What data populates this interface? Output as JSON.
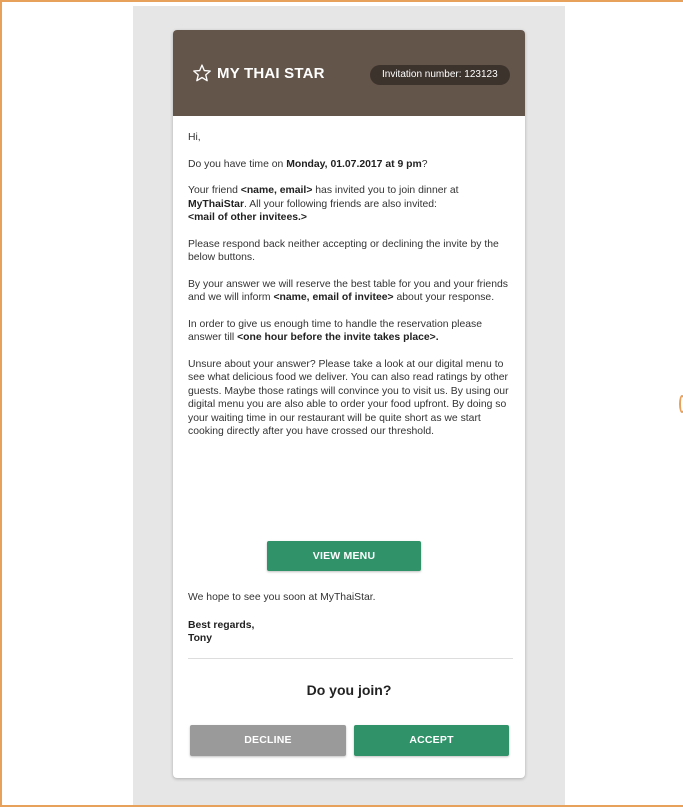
{
  "header": {
    "brand": "MY THAI STAR",
    "invitation": "Invitation number: 123123"
  },
  "body": {
    "greeting": "Hi,",
    "q_prefix": "Do you have time on ",
    "q_date": "Monday, 01.07.2017 at 9 pm",
    "q_suffix": "?",
    "friend_prefix": "Your friend ",
    "friend_name": "<name, email>",
    "friend_mid": " has invited you to join dinner at ",
    "friend_brand": "MyThaiStar",
    "friend_suffix": ". All your following friends are also invited: ",
    "friend_others": "<mail of other invitees.>",
    "respond": "Please respond back neither accepting or declining the invite by the below buttons.",
    "reserve_prefix": "By your answer we will reserve the best table for you and your friends and we will inform ",
    "reserve_name": "<name, email of invitee>",
    "reserve_suffix": " about your response.",
    "order_prefix": "In order to give us enough time to handle the reservation please answer till ",
    "order_time": "<one hour before the invite takes place>.",
    "unsure": "Unsure about your answer? Please take a look at our digital menu to see what delicious food we deliver. You can also read ratings by other guests. Maybe those ratings will convince you to visit us. By using our digital menu you are also able to order your food upfront.  By doing so your waiting time in our restaurant will be quite short as we start cooking directly after you have crossed our threshold.",
    "view_menu": "VIEW MENU",
    "hope": "We hope to see you soon at MyThaiStar.",
    "regards": "Best regards,",
    "signature": "Tony"
  },
  "footer": {
    "question": "Do you join?",
    "decline": "DECLINE",
    "accept": "ACCEPT"
  },
  "colors": {
    "header_bg": "#64554a",
    "badge_bg": "#3d332d",
    "accent_green": "#2f9268",
    "decline_gray": "#9a9a9a",
    "frame_orange": "#e8a15a"
  },
  "icons": {
    "brand_icon": "star-outline-icon"
  }
}
